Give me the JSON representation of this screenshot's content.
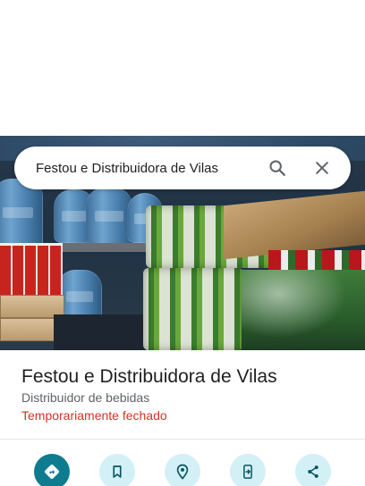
{
  "search": {
    "query": "Festou e Distribuidora de Vilas"
  },
  "place": {
    "name": "Festou e Distribuidora de Vilas",
    "category": "Distribuidor de bebidas",
    "status": "Temporariamente fechado"
  },
  "actions": [
    {
      "icon": "directions-icon"
    },
    {
      "icon": "save-bookmark-icon"
    },
    {
      "icon": "nearby-location-icon"
    },
    {
      "icon": "send-to-phone-icon"
    },
    {
      "icon": "share-icon"
    }
  ],
  "colors": {
    "primary_action": "#0e7c8f",
    "secondary_action_bg": "#d3f0f7",
    "status_closed": "#d93025"
  }
}
